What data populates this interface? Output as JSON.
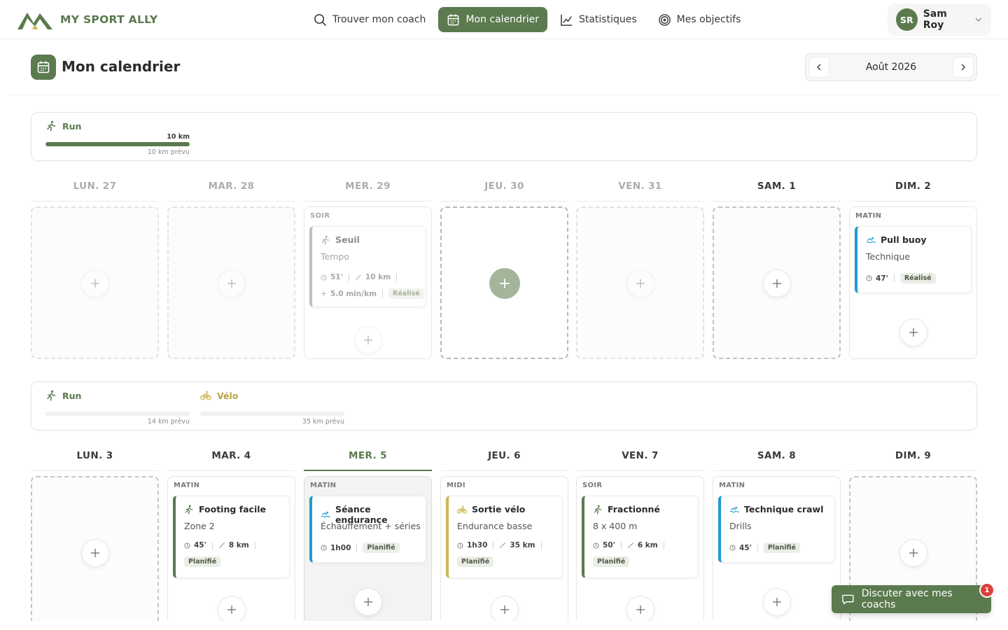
{
  "app": {
    "name": "MY SPORT ALLY"
  },
  "nav": {
    "items": [
      {
        "label": "Trouver mon coach",
        "icon": "search-icon",
        "active": false
      },
      {
        "label": "Mon calendrier",
        "icon": "calendar-icon",
        "active": true
      },
      {
        "label": "Statistiques",
        "icon": "chart-line-icon",
        "active": false
      },
      {
        "label": "Mes objectifs",
        "icon": "target-icon",
        "active": false
      }
    ]
  },
  "user": {
    "initials": "SR",
    "name": "Sam Roy"
  },
  "page": {
    "title": "Mon calendrier",
    "month": "Août 2026"
  },
  "weeks": [
    {
      "summary": [
        {
          "sport": "Run",
          "done": "10 km",
          "planned": "10 km prévu",
          "progress": 1.0
        }
      ],
      "days": [
        {
          "label": "LUN. 27"
        },
        {
          "label": "MAR. 28"
        },
        {
          "label": "MER. 29",
          "slot": "SOIR",
          "session": {
            "title": "Seuil",
            "sub": "Tempo",
            "duration": "51'",
            "distance": "10 km",
            "pace": "5.0 min/km",
            "status": "Réalisé"
          }
        },
        {
          "label": "JEU. 30"
        },
        {
          "label": "VEN. 31"
        },
        {
          "label": "SAM. 1"
        },
        {
          "label": "DIM. 2",
          "slot": "MATIN",
          "session": {
            "title": "Pull buoy",
            "sub": "Technique",
            "duration": "47'",
            "status": "Réalisé"
          }
        }
      ]
    },
    {
      "summary": [
        {
          "sport": "Run",
          "planned": "14 km prévu",
          "progress": 0
        },
        {
          "sport": "Vélo",
          "planned": "35 km prévu",
          "progress": 0
        }
      ],
      "days": [
        {
          "label": "LUN. 3"
        },
        {
          "label": "MAR. 4",
          "slot": "MATIN",
          "session": {
            "title": "Footing facile",
            "sub": "Zone 2",
            "duration": "45'",
            "distance": "8 km",
            "status": "Planifié"
          }
        },
        {
          "label": "MER. 5",
          "slot": "MATIN",
          "session": {
            "title": "Séance endurance",
            "sub": "Échauffement + séries",
            "duration": "1h00",
            "status": "Planifié"
          }
        },
        {
          "label": "JEU. 6",
          "slot": "MIDI",
          "session": {
            "title": "Sortie vélo",
            "sub": "Endurance basse",
            "duration": "1h30",
            "distance": "35 km",
            "status": "Planifié"
          }
        },
        {
          "label": "VEN. 7",
          "slot": "SOIR",
          "session": {
            "title": "Fractionné",
            "sub": "8 x 400 m",
            "duration": "50'",
            "distance": "6 km",
            "status": "Planifié"
          }
        },
        {
          "label": "SAM. 8",
          "slot": "MATIN",
          "session": {
            "title": "Technique crawl",
            "sub": "Drills",
            "duration": "45'",
            "status": "Planifié"
          }
        },
        {
          "label": "DIM. 9"
        }
      ]
    }
  ],
  "chat": {
    "label": "Discuter avec mes coachs",
    "badge": "1"
  },
  "colors": {
    "brand": "#5b7a4e",
    "swim": "#1f9ad6",
    "bike": "#cdb74e",
    "alert": "#d9413b"
  }
}
